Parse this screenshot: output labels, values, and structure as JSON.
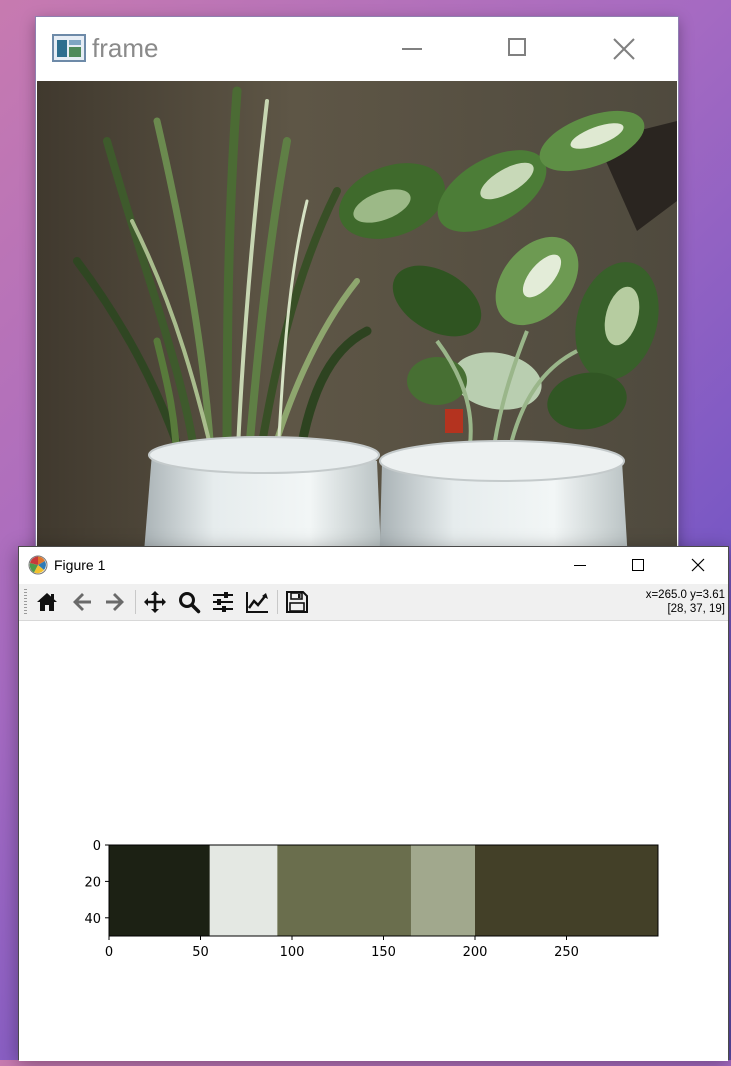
{
  "frame_window": {
    "title": "frame",
    "minimize_icon": "minimize-icon",
    "maximize_icon": "maximize-icon",
    "close_icon": "close-icon"
  },
  "figure_window": {
    "title": "Figure 1",
    "app_icon": "matplotlib-logo-icon",
    "toolbar": {
      "buttons": [
        "home-icon",
        "back-arrow-icon",
        "forward-arrow-icon",
        "pan-move-icon",
        "zoom-magnifier-icon",
        "subplot-config-icon",
        "edit-axes-icon",
        "save-floppy-icon"
      ],
      "coord_line1": "x=265.0 y=3.61",
      "coord_line2": "[28, 37, 19]"
    }
  },
  "chart_data": {
    "type": "heatmap",
    "title": "",
    "xlabel": "",
    "ylabel": "",
    "xlim": [
      0,
      300
    ],
    "ylim": [
      50,
      0
    ],
    "x_ticks": [
      "0",
      "50",
      "100",
      "150",
      "200",
      "250"
    ],
    "y_ticks": [
      "0",
      "20",
      "40"
    ],
    "segments": [
      {
        "start": 0,
        "end": 55,
        "color": "#1c2114"
      },
      {
        "start": 55,
        "end": 92,
        "color": "#e4e8e3"
      },
      {
        "start": 92,
        "end": 165,
        "color": "#6a6e4d"
      },
      {
        "start": 165,
        "end": 200,
        "color": "#a1a88d"
      },
      {
        "start": 200,
        "end": 300,
        "color": "#434028"
      }
    ]
  }
}
